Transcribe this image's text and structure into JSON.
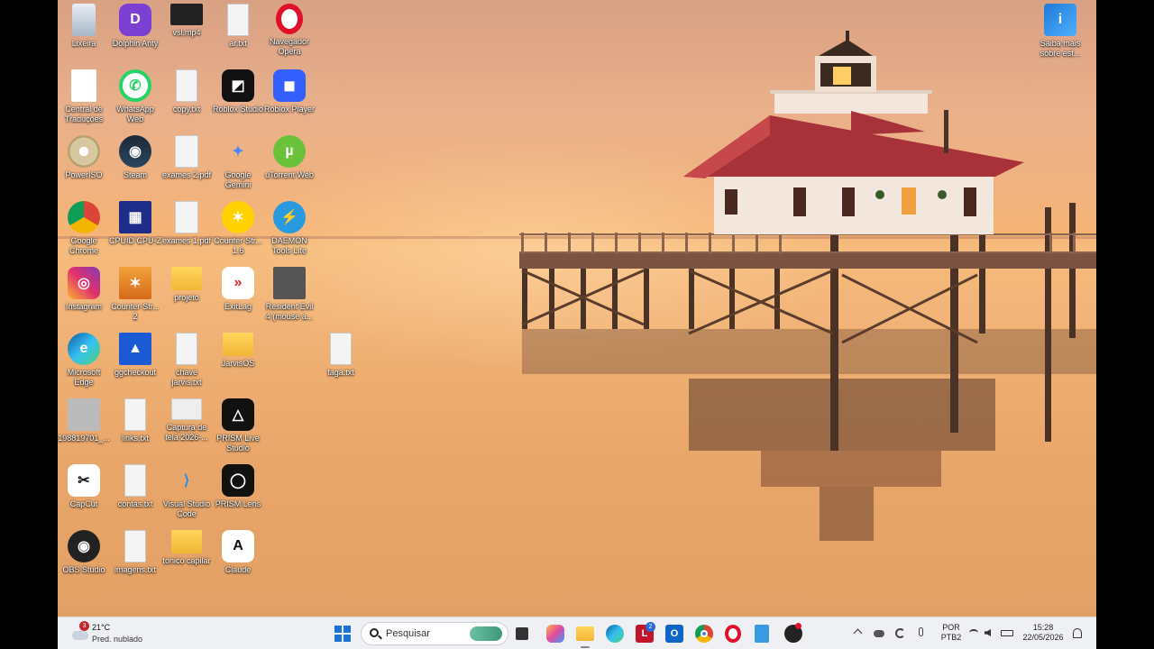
{
  "desktop": {
    "icons": [
      {
        "id": "lixeira",
        "label": "Lixeira",
        "icon": "recycle-bin-icon"
      },
      {
        "id": "dolphin",
        "label": "Dolphin Anty",
        "icon": "dolphin-anty-icon"
      },
      {
        "id": "vslmp4",
        "label": "vsl.mp4",
        "icon": "video-file-icon"
      },
      {
        "id": "artxt",
        "label": "ar.txt",
        "icon": "text-file-icon"
      },
      {
        "id": "opera",
        "label": "Navegador Opera",
        "icon": "opera-icon"
      },
      {
        "id": "central",
        "label": "Central de Traduções",
        "icon": "chrome-doc-icon"
      },
      {
        "id": "whatsapp",
        "label": "WhatsApp Web",
        "icon": "whatsapp-icon"
      },
      {
        "id": "copytxt",
        "label": "copy.txt",
        "icon": "text-file-icon"
      },
      {
        "id": "robloxstudio",
        "label": "Roblox Studio",
        "icon": "roblox-studio-icon"
      },
      {
        "id": "robloxplayer",
        "label": "Roblox Player",
        "icon": "roblox-player-icon"
      },
      {
        "id": "poweriso",
        "label": "PowerISO",
        "icon": "poweriso-icon"
      },
      {
        "id": "steam",
        "label": "Steam",
        "icon": "steam-icon"
      },
      {
        "id": "exames2",
        "label": "exames 2.pdf",
        "icon": "pdf-file-icon"
      },
      {
        "id": "gemini",
        "label": "Google Gemini",
        "icon": "gemini-icon"
      },
      {
        "id": "utorrent",
        "label": "uTorrent Web",
        "icon": "utorrent-icon"
      },
      {
        "id": "chrome",
        "label": "Google Chrome",
        "icon": "chrome-icon"
      },
      {
        "id": "cpuid",
        "label": "CPUID CPU-Z",
        "icon": "cpuz-icon"
      },
      {
        "id": "exames1",
        "label": "exames 1.pdf",
        "icon": "pdf-file-icon"
      },
      {
        "id": "counterstrike16",
        "label": "Counter-Str... 1.6",
        "icon": "counter-strike-icon"
      },
      {
        "id": "daemon",
        "label": "DAEMON Tools Lite",
        "icon": "daemon-tools-icon"
      },
      {
        "id": "instagram",
        "label": "Instagram",
        "icon": "instagram-icon"
      },
      {
        "id": "counterstrike2",
        "label": "Counter-Str... 2",
        "icon": "cs2-icon"
      },
      {
        "id": "projeto",
        "label": "projeto",
        "icon": "folder-icon"
      },
      {
        "id": "exitlag",
        "label": "ExitLag",
        "icon": "exitlag-icon"
      },
      {
        "id": "residentevil",
        "label": "Resident Evil 4 (mouse a...",
        "icon": "resident-evil-icon"
      },
      {
        "id": "edge",
        "label": "Microsoft Edge",
        "icon": "edge-icon"
      },
      {
        "id": "ggcheckout",
        "label": "ggcheckout",
        "icon": "ggcheckout-icon"
      },
      {
        "id": "chavejarvis",
        "label": "chave jarvis.txt",
        "icon": "text-file-icon"
      },
      {
        "id": "jarvisos",
        "label": "JarvisOS",
        "icon": "folder-icon"
      },
      {
        "id": "tagatxt",
        "label": "taga.txt",
        "icon": "text-file-icon"
      },
      {
        "id": "photo1",
        "label": "198819701_...",
        "icon": "photo-file-icon"
      },
      {
        "id": "linkstxt",
        "label": "links.txt",
        "icon": "text-file-icon"
      },
      {
        "id": "captura",
        "label": "Captura de tela 2026-...",
        "icon": "image-file-icon"
      },
      {
        "id": "prismlive",
        "label": "PRISM Live Studio",
        "icon": "prism-live-icon"
      },
      {
        "id": "capcut",
        "label": "CapCut",
        "icon": "capcut-icon"
      },
      {
        "id": "contastxt",
        "label": "contas.txt",
        "icon": "text-file-icon"
      },
      {
        "id": "vscode",
        "label": "Visual Studio Code",
        "icon": "vscode-icon"
      },
      {
        "id": "prismlens",
        "label": "PRISM Lens",
        "icon": "prism-lens-icon"
      },
      {
        "id": "obs",
        "label": "OBS Studio",
        "icon": "obs-icon"
      },
      {
        "id": "imagenstxt",
        "label": "imagens.txt",
        "icon": "text-file-icon"
      },
      {
        "id": "tonico",
        "label": "tonico capilar",
        "icon": "folder-icon"
      },
      {
        "id": "claude",
        "label": "Claude",
        "icon": "claude-icon"
      }
    ],
    "saiba": {
      "label": "Saiba mais sobre est...",
      "icon": "info-picture-icon"
    }
  },
  "taskbar": {
    "weather": {
      "temp": "21°C",
      "desc": "Pred. nublado",
      "badge": "3",
      "icon": "weather-cloud-icon"
    },
    "search": {
      "placeholder": "Pesquisar",
      "icon": "search-icon"
    },
    "apps": [
      {
        "id": "start",
        "icon": "windows-start-icon"
      },
      {
        "id": "taskview",
        "icon": "task-view-icon"
      },
      {
        "id": "copilot",
        "icon": "copilot-icon"
      },
      {
        "id": "explorer",
        "icon": "file-explorer-icon"
      },
      {
        "id": "edge",
        "icon": "edge-icon"
      },
      {
        "id": "lapp",
        "icon": "l-app-icon",
        "badge": "2"
      },
      {
        "id": "outlook",
        "icon": "outlook-icon"
      },
      {
        "id": "chrome",
        "icon": "chrome-icon"
      },
      {
        "id": "opera",
        "icon": "opera-icon"
      },
      {
        "id": "notepad",
        "icon": "notepad-icon"
      },
      {
        "id": "obs",
        "icon": "obs-icon"
      }
    ],
    "tray": {
      "lang": "POR",
      "layout": "PTB2",
      "time": "15:28",
      "date": "22/05/2026"
    }
  },
  "colors": {
    "taskbar_bg": "#eef0f4",
    "sky_top": "#d9a184",
    "water": "#e9a66a"
  }
}
